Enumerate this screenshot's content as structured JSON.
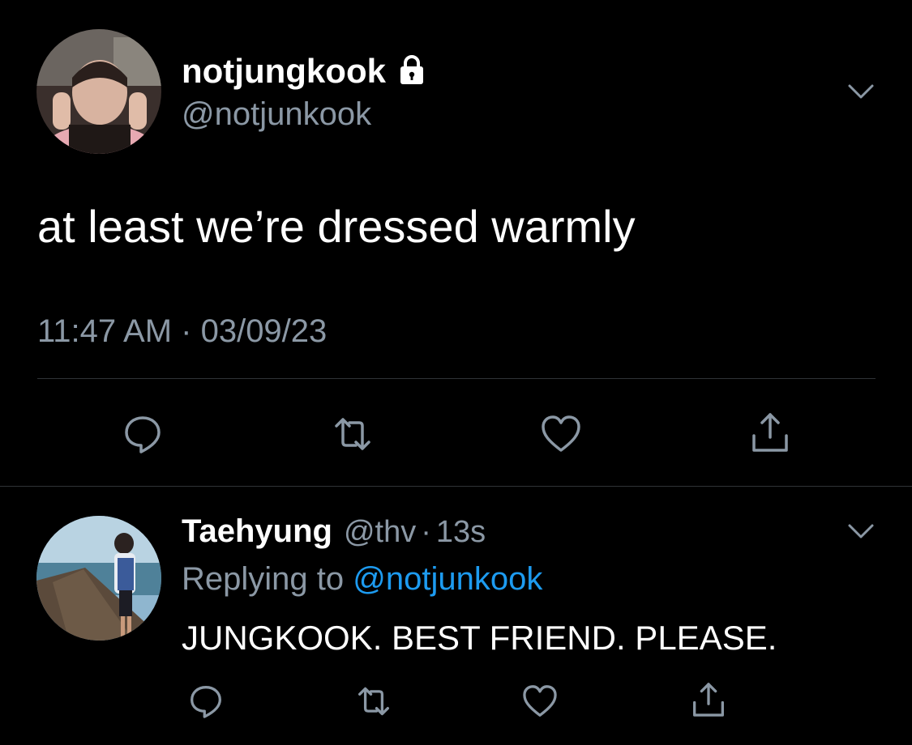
{
  "colors": {
    "background": "#000000",
    "primary_text": "#ffffff",
    "secondary_text": "#8b98a5",
    "link": "#1d9bf0",
    "divider": "#2f3336"
  },
  "main_tweet": {
    "display_name": "notjungkook",
    "protected_icon": "lock-icon",
    "handle": "@notjunkook",
    "text": "at least we’re dressed warmly",
    "timestamp": "11:47 AM · 03/09/23",
    "actions": [
      "reply-icon",
      "retweet-icon",
      "like-icon",
      "share-icon"
    ]
  },
  "reply": {
    "display_name": "Taehyung",
    "handle": "@thv",
    "separator": "·",
    "time_ago": "13s",
    "replying_to_label": "Replying to",
    "replying_to_handle": "@notjunkook",
    "text": "JUNGKOOK. BEST FRIEND. PLEASE.",
    "actions": [
      "reply-icon",
      "retweet-icon",
      "like-icon",
      "share-icon"
    ]
  }
}
